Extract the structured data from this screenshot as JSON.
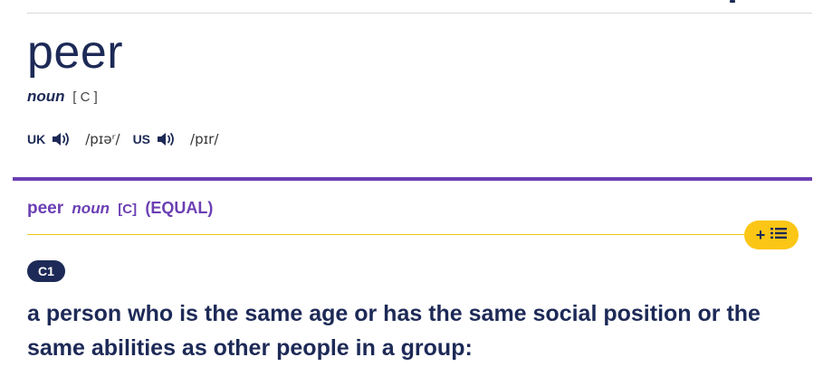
{
  "entry": {
    "headword": "peer",
    "part_of_speech": "noun",
    "grammar": "[ C ]"
  },
  "pronunciation": {
    "uk": {
      "region": "UK",
      "ipa": "/pɪəʳ/"
    },
    "us": {
      "region": "US",
      "ipa": "/pɪr/"
    }
  },
  "sense": {
    "headword": "peer",
    "part_of_speech": "noun",
    "grammar": "[C]",
    "guide_word": "(EQUAL)",
    "level": "C1",
    "add_button_label": "+",
    "definition": "a person who is the same age or has the same social position or the same abilities as other people in a group:"
  },
  "colors": {
    "primary_text": "#1d2a57",
    "accent_purple": "#6b3fb3",
    "button_yellow": "#fbc616"
  }
}
